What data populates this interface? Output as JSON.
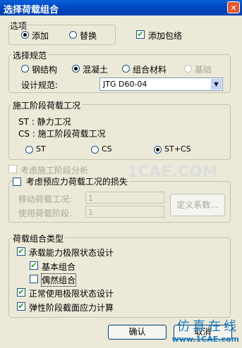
{
  "window": {
    "title": "选择荷载组合",
    "close_glyph": "✕"
  },
  "option": {
    "legend": "选项",
    "add": {
      "label": "添加",
      "selected": true
    },
    "replace": {
      "label": "替换",
      "selected": false
    },
    "envelope": {
      "label": "添加包络",
      "checked": true
    }
  },
  "spec": {
    "legend": "选择规范",
    "steel": {
      "label": "钢结构",
      "selected": false
    },
    "concrete": {
      "label": "混凝土",
      "selected": true
    },
    "composite": {
      "label": "组合材料",
      "selected": false
    },
    "foundation": {
      "label": "基础",
      "disabled": true
    },
    "design_code_label": "设计规范:",
    "design_code_value": "JTG D60-04"
  },
  "stage": {
    "legend": "施工阶段荷载工况",
    "st_line": "ST :  静力工况",
    "cs_line": "CS :  施工阶段荷载工况",
    "opt_st": "ST",
    "opt_cs": "CS",
    "opt_stcs": "ST+CS",
    "selected": "ST+CS"
  },
  "consider_stage": {
    "label": "考虑施工阶段分析",
    "checked": false
  },
  "prestress": {
    "legend": "考虑预应力荷载工况的损失",
    "moving_label": "移动荷载工况:",
    "moving_value": "1",
    "using_label": "使用荷载阶段:",
    "using_value": "1",
    "define_coeff_button": "定义系数..."
  },
  "combo": {
    "legend": "荷载组合类型",
    "uls": {
      "label": "承载能力极限状态设计",
      "checked": true
    },
    "basic": {
      "label": "基本组合",
      "checked": true
    },
    "accidental": {
      "label": "偶然组合",
      "checked": false
    },
    "sls": {
      "label": "正常使用极限状态设计",
      "checked": true
    },
    "elastic": {
      "label": "弹性阶段截面应力计算",
      "checked": true
    }
  },
  "footer": {
    "ok": "确认",
    "cancel": "取消"
  },
  "watermark": {
    "text": "1CAE.COM",
    "brand_cn": "仿真在线",
    "brand_url": "www.1CAE.com"
  },
  "icons": {
    "check": "✔",
    "dropdown": "▼"
  }
}
